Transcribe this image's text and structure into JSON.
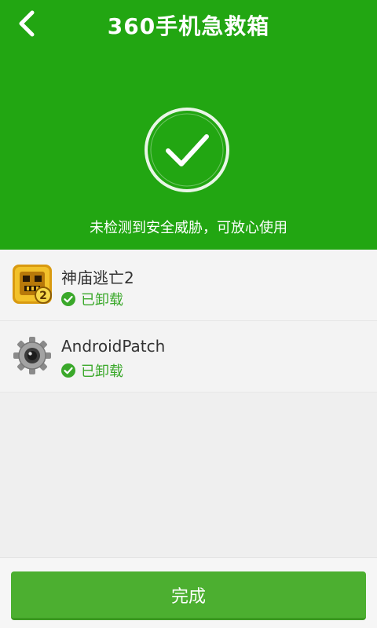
{
  "header": {
    "title": "360手机急救箱",
    "message": "未检测到安全威胁，可放心使用"
  },
  "apps": [
    {
      "name": "神庙逃亡2",
      "status": "已卸载",
      "icon": "temple-run-2-icon"
    },
    {
      "name": "AndroidPatch",
      "status": "已卸载",
      "icon": "gear-icon"
    }
  ],
  "footer": {
    "done_label": "完成"
  },
  "colors": {
    "brand_green": "#22a612",
    "status_green": "#3aa82a",
    "button_green": "#4caf30"
  }
}
